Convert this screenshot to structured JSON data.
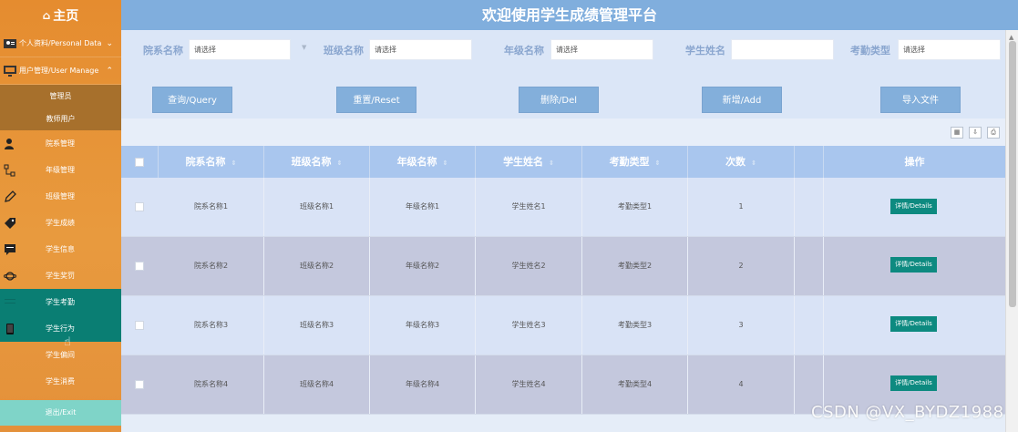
{
  "header": {
    "title": "欢迎使用学生成绩管理平台"
  },
  "sidebar": {
    "home": "主页",
    "personal": "个人资料/Personal Data",
    "user_manage": "用户管理/User Manage",
    "sub_items": [
      "管理员",
      "教师用户"
    ],
    "items": [
      "院系管理",
      "年级管理",
      "班级管理",
      "学生成绩",
      "学生信息",
      "学生奖罚",
      "学生考勤",
      "学生行为",
      "学生偏间",
      "学生消费"
    ],
    "exit": "退出/Exit"
  },
  "search": {
    "fields": [
      {
        "label": "院系名称",
        "placeholder": "请选择"
      },
      {
        "label": "班级名称",
        "placeholder": "请选择"
      },
      {
        "label": "年级名称",
        "placeholder": "请选择"
      },
      {
        "label": "学生姓名",
        "placeholder": ""
      },
      {
        "label": "考勤类型",
        "placeholder": "请选择"
      }
    ],
    "buttons": {
      "query": "查询/Query",
      "reset": "重置/Reset",
      "delete": "删除/Del",
      "add": "新增/Add",
      "import": "导入文件"
    }
  },
  "table": {
    "headers": [
      "院系名称",
      "班级名称",
      "年级名称",
      "学生姓名",
      "考勤类型",
      "次数",
      "",
      "操作"
    ],
    "rows": [
      [
        "院系名称1",
        "班级名称1",
        "年级名称1",
        "学生姓名1",
        "考勤类型1",
        "1"
      ],
      [
        "院系名称2",
        "班级名称2",
        "年级名称2",
        "学生姓名2",
        "考勤类型2",
        "2"
      ],
      [
        "院系名称3",
        "班级名称3",
        "年级名称3",
        "学生姓名3",
        "考勤类型3",
        "3"
      ],
      [
        "院系名称4",
        "班级名称4",
        "年级名称4",
        "学生姓名4",
        "考勤类型4",
        "4"
      ]
    ],
    "details_label": "详情/Details"
  },
  "watermark": "CSDN @VX_BYDZ1988",
  "colors": {
    "sidebar": "#e58c2f",
    "active": "#0a7e73",
    "header": "#80aedd",
    "button": "#83afdb"
  }
}
